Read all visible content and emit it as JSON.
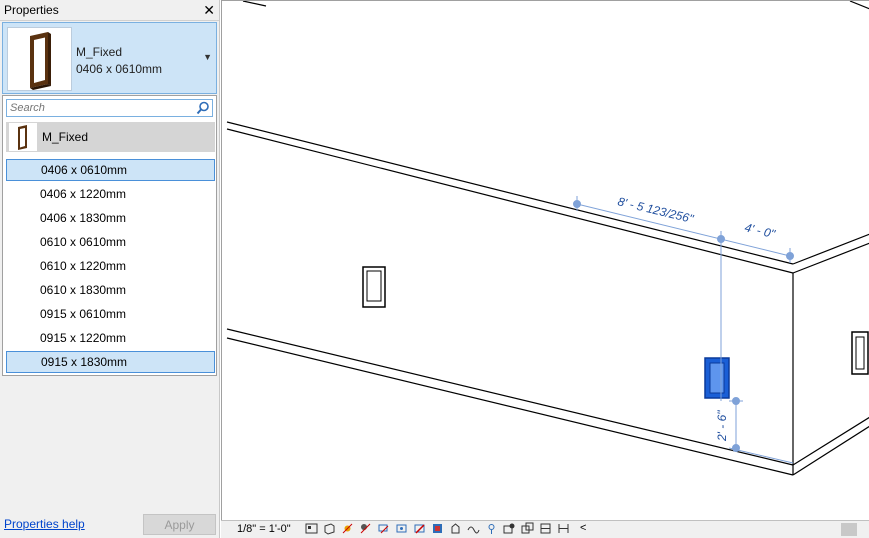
{
  "properties": {
    "title": "Properties",
    "close_glyph": "✕",
    "type_selector": {
      "family": "M_Fixed",
      "size": "0406 x 0610mm",
      "thumbnail_icon": "fixed-window-thumbnail-icon",
      "chevron": "▼"
    },
    "dropdown": {
      "search_placeholder": "Search",
      "family_label": "M_Fixed",
      "items": [
        {
          "label": "0406 x 0610mm",
          "selected": true
        },
        {
          "label": "0406 x 1220mm",
          "selected": false
        },
        {
          "label": "0406 x 1830mm",
          "selected": false
        },
        {
          "label": "0610 x 0610mm",
          "selected": false
        },
        {
          "label": "0610 x 1220mm",
          "selected": false
        },
        {
          "label": "0610 x 1830mm",
          "selected": false
        },
        {
          "label": "0915 x 0610mm",
          "selected": false
        },
        {
          "label": "0915 x 1220mm",
          "selected": false
        },
        {
          "label": "0915 x 1830mm",
          "selected": false,
          "hovered": true
        }
      ]
    },
    "help_link": "Properties help",
    "apply_label": "Apply"
  },
  "viewport": {
    "dimensions": {
      "long": "8' - 5 123/256\"",
      "short": "4' - 0\"",
      "vertical": "2' - 6\""
    },
    "colors": {
      "dimension": "#1f4e9e",
      "selected_window": "#1a5fd6",
      "edges": "#000000"
    }
  },
  "status_bar": {
    "scale": "1/8\" = 1'-0\"",
    "icons": [
      "detail-level-icon",
      "visual-style-icon",
      "sun-path-icon",
      "shadows-icon",
      "crop-view-icon",
      "show-crop-icon",
      "temporary-hide-icon",
      "reveal-hidden-icon",
      "lock-3d-icon",
      "analytical-model-icon",
      "highlight-displacement-icon",
      "worksharing-icon",
      "design-options-icon",
      "view-template-icon",
      "reveal-constraints-icon"
    ],
    "scroll_glyph": "<"
  }
}
